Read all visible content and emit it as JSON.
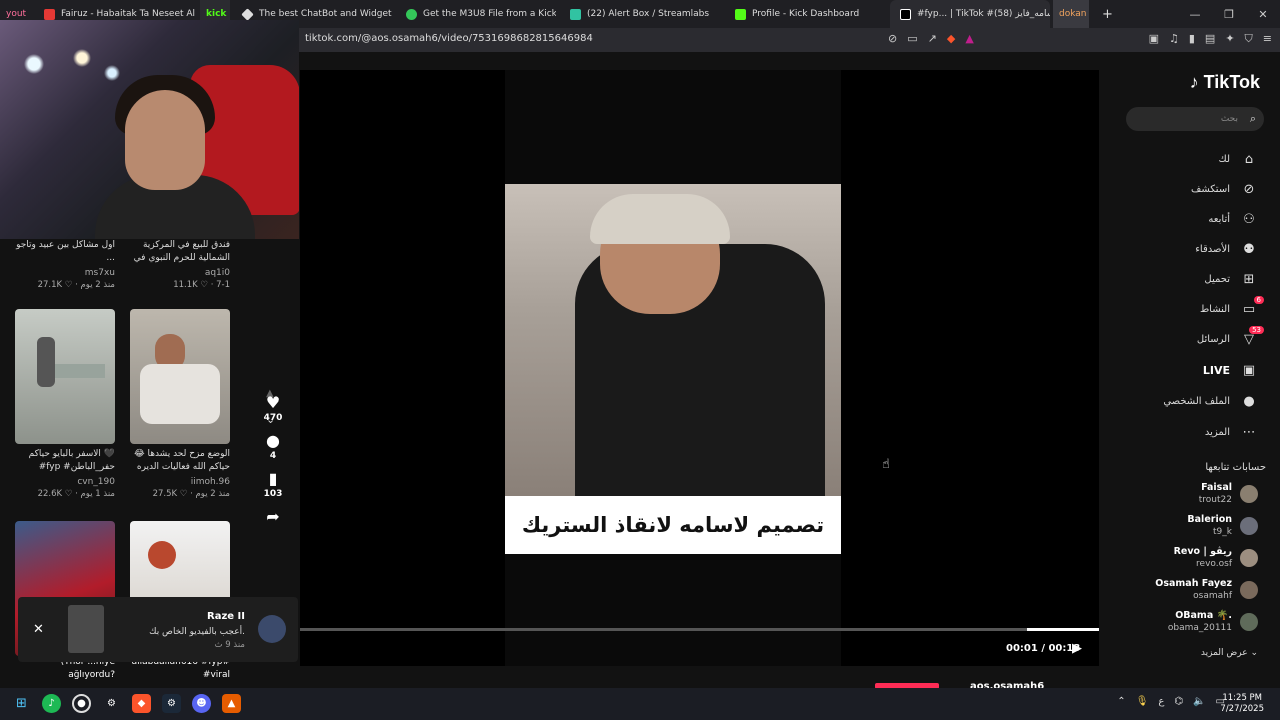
{
  "tabs": [
    {
      "label": "yout",
      "color": "#e91e63"
    },
    {
      "label": "Fairuz - Habaitak Ta Neseet Al Naoum",
      "color": "#e53935"
    },
    {
      "label": "kick",
      "color": "#53fc18"
    },
    {
      "label": "The best ChatBot and Widgets for Ki",
      "color": "#ffffff"
    },
    {
      "label": "Get the M3U8 File from a Kick Replay",
      "color": "#34c759"
    },
    {
      "label": "(22) Alert Box / Streamlabs",
      "color": "#31c3a2"
    },
    {
      "label": "Profile - Kick Dashboard",
      "color": "#53fc18"
    },
    {
      "label": "#fyp... | TikTok #اسامه_فايز (58)",
      "color": "#ffffff"
    },
    {
      "label": "dokan",
      "color": "#f0a35e"
    }
  ],
  "address": {
    "url": "tiktok.com/@aos.osamah6/video/7531698682815646984"
  },
  "grid": {
    "cards": [
      {
        "caption": "اول مشاكل بين عبيد وتاجو ...",
        "user": "ms7xu",
        "meta": "27.1K ♡ · منذ 2 يوم"
      },
      {
        "caption": "فندق للبيع في المركزية الشمالية للحرم النبوي في المدينه المنو...",
        "user": "aq1i0",
        "meta": "11.1K ♡ · 7-1"
      },
      {
        "caption": "الاسفر بالبايو حياكم 🖤 #fyp #حفر_الباطن",
        "user": "cvn_190",
        "meta": "22.6K ♡ · منذ 1 يوم"
      },
      {
        "caption": "الوضع مزح لحد يشدها 😂 حياكم الله فعاليات الديره في...",
        "user": "iimoh.96",
        "meta": "27.5K ♡ · منذ 2 يوم"
      },
      {
        "caption": "(Thor ...niye ağlıyordu?",
        "user": "",
        "meta": ""
      },
      {
        "caption": "allabdallah616 #fyp# #viral",
        "user": "",
        "meta": ""
      }
    ]
  },
  "video": {
    "caption": "تصميم لاسامه لانقاذ الستريك",
    "likes": "470",
    "comments": "4",
    "bookmarks": "103",
    "time": "00:01 / 00:13",
    "progress": 0.09,
    "author": "aos.osamah6"
  },
  "sidebar": {
    "logo": "TikTok",
    "search_placeholder": "بحث",
    "nav": [
      {
        "label": "لك",
        "icon": "home-icon",
        "glyph": "⌂"
      },
      {
        "label": "استكشف",
        "icon": "explore-icon",
        "glyph": "⊘"
      },
      {
        "label": "أتابعه",
        "icon": "following-icon",
        "glyph": "⚇"
      },
      {
        "label": "الأصدقاء",
        "icon": "friends-icon",
        "glyph": "⚉"
      },
      {
        "label": "تحميل",
        "icon": "upload-icon",
        "glyph": "⊞"
      },
      {
        "label": "النشاط",
        "icon": "activity-icon",
        "glyph": "▭",
        "badge": "6"
      },
      {
        "label": "الرسائل",
        "icon": "messages-icon",
        "glyph": "▽",
        "badge": "53"
      },
      {
        "label": "LIVE",
        "icon": "live-icon",
        "glyph": "▣"
      },
      {
        "label": "الملف الشخصي",
        "icon": "profile-icon",
        "glyph": "●"
      },
      {
        "label": "المزيد",
        "icon": "more-icon",
        "glyph": "⋯"
      }
    ],
    "following_header": "حسابات تتابعها",
    "accounts": [
      {
        "name": "Faisal",
        "handle": "trout22"
      },
      {
        "name": "Balerion",
        "handle": "t9_k"
      },
      {
        "name": "Revo | ريڤو",
        "handle": "revo.osf"
      },
      {
        "name": "Osamah Fayez",
        "handle": "osamahf"
      },
      {
        "name": "OBama 🌴.",
        "handle": "obama_20111"
      }
    ],
    "see_more": "عرض المزيد"
  },
  "notification": {
    "name": "Raze II",
    "message": "أعجب بالفيديو الخاص بك.",
    "time": "منذ 9 ث"
  },
  "taskbar": {
    "time": "11:25 PM",
    "date": "7/27/2025",
    "lang": "ع"
  },
  "colors": {
    "accent": "#fe2c55",
    "kick": "#53fc18"
  }
}
